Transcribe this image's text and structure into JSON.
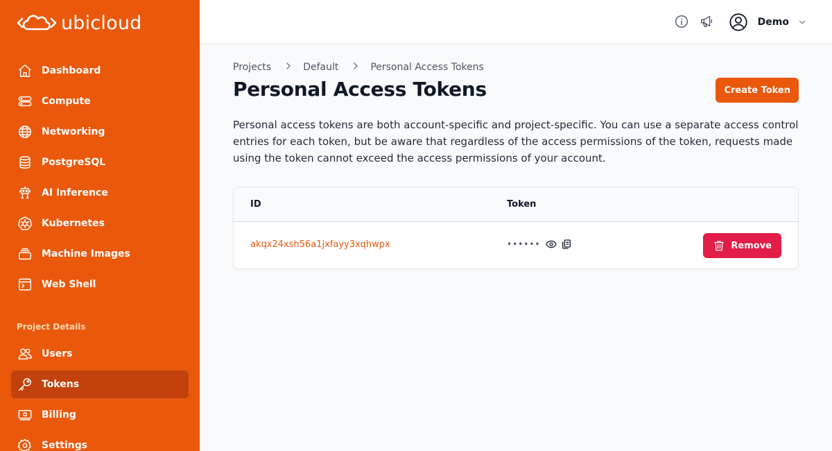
{
  "app": {
    "name": "ubicloud"
  },
  "sidebar": {
    "items": [
      {
        "label": "Dashboard",
        "icon": "home-icon"
      },
      {
        "label": "Compute",
        "icon": "server-icon"
      },
      {
        "label": "Networking",
        "icon": "globe-icon"
      },
      {
        "label": "PostgreSQL",
        "icon": "database-icon"
      },
      {
        "label": "AI Inference",
        "icon": "robot-icon"
      },
      {
        "label": "Kubernetes",
        "icon": "kubernetes-icon"
      },
      {
        "label": "Machine Images",
        "icon": "stack-icon"
      },
      {
        "label": "Web Shell",
        "icon": "terminal-icon"
      }
    ],
    "section_title": "Project Details",
    "project_items": [
      {
        "label": "Users",
        "icon": "users-icon"
      },
      {
        "label": "Tokens",
        "icon": "key-icon",
        "active": true
      },
      {
        "label": "Billing",
        "icon": "billing-icon"
      },
      {
        "label": "Settings",
        "icon": "gear-icon"
      }
    ]
  },
  "header": {
    "user_name": "Demo"
  },
  "breadcrumb": [
    "Projects",
    "Default",
    "Personal Access Tokens"
  ],
  "page": {
    "title": "Personal Access Tokens",
    "create_button": "Create Token",
    "description": "Personal access tokens are both account-specific and project-specific. You can use a separate access control entries for each token, but be aware that regardless of the access permissions of the token, requests made using the token cannot exceed the access permissions of your account."
  },
  "table": {
    "columns": [
      "ID",
      "Token"
    ],
    "rows": [
      {
        "id": "akqx24xsh56a1jxfayy3xqhwpx",
        "token_mask": "••••••",
        "remove_label": "Remove"
      }
    ]
  },
  "colors": {
    "brand": "#ea580c",
    "sidebar_active": "#c2410c",
    "danger": "#e11d48"
  }
}
